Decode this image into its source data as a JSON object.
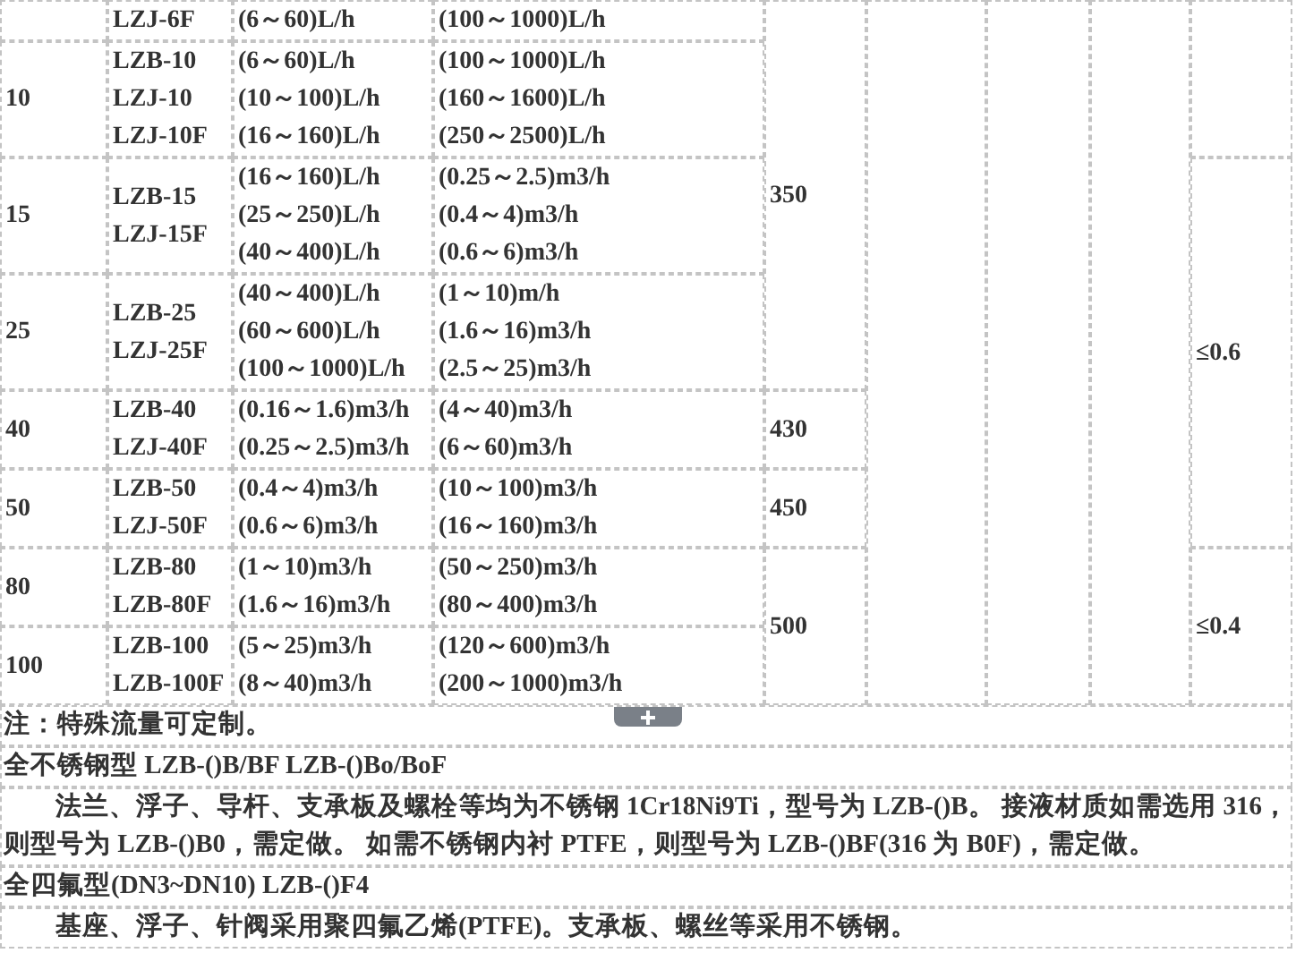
{
  "table": {
    "rows": [
      {
        "models": [
          "LZJ-6F"
        ],
        "range_1": [
          "(6～60)L/h"
        ],
        "range_2": [
          "(100～1000)L/h"
        ],
        "pressure": "350",
        "max_pressure": null
      },
      {
        "dn": "10",
        "models": [
          "LZB-10",
          "LZJ-10",
          "LZJ-10F"
        ],
        "range_1": [
          "(6～60)L/h",
          "(10～100)L/h",
          "(16～160)L/h"
        ],
        "range_2": [
          "(100～1000)L/h",
          "(160～1600)L/h",
          "(250～2500)L/h"
        ]
      },
      {
        "dn": "15",
        "models": [
          "LZB-15",
          "LZJ-15F"
        ],
        "range_1": [
          "(16～160)L/h",
          "(25～250)L/h",
          "(40～400)L/h"
        ],
        "range_2": [
          "(0.25～2.5)m3/h",
          "(0.4～4)m3/h",
          "(0.6～6)m3/h"
        ],
        "max_pressure": "≤0.6"
      },
      {
        "dn": "25",
        "models": [
          "LZB-25",
          "LZJ-25F"
        ],
        "range_1": [
          "(40～400)L/h",
          "(60～600)L/h",
          "(100～1000)L/h"
        ],
        "range_2": [
          "(1～10)m/h",
          "(1.6～16)m3/h",
          "(2.5～25)m3/h"
        ]
      },
      {
        "dn": "40",
        "models": [
          "LZB-40",
          "LZJ-40F"
        ],
        "range_1": [
          "(0.16～1.6)m3/h",
          "(0.25～2.5)m3/h"
        ],
        "range_2": [
          "(4～40)m3/h",
          "(6～60)m3/h"
        ],
        "pressure": "430"
      },
      {
        "dn": "50",
        "models": [
          "LZB-50",
          "LZJ-50F"
        ],
        "range_1": [
          "(0.4～4)m3/h",
          "(0.6～6)m3/h"
        ],
        "range_2": [
          "(10～100)m3/h",
          "(16～160)m3/h"
        ],
        "pressure": "450"
      },
      {
        "dn": "80",
        "models": [
          "LZB-80",
          "LZB-80F"
        ],
        "range_1": [
          "(1～10)m3/h",
          "(1.6～16)m3/h"
        ],
        "range_2": [
          "(50～250)m3/h",
          "(80～400)m3/h"
        ],
        "pressure": "500",
        "max_pressure": "≤0.4"
      },
      {
        "dn": "100",
        "models": [
          "LZB-100",
          "LZB-100F"
        ],
        "range_1": [
          "(5～25)m3/h",
          "(8～40)m3/h"
        ],
        "range_2": [
          "(120～600)m3/h",
          "(200～1000)m3/h"
        ]
      }
    ]
  },
  "note": "注：特殊流量可定制。",
  "sections": [
    {
      "heading": "全不锈钢型 LZB-()B/BF LZB-()Bo/BoF",
      "text": "法兰、浮子、导杆、支承板及螺栓等均为不锈钢 1Cr18Ni9Ti，型号为 LZB-()B。 接液材质如需选用 316，则型号为 LZB-()B0，需定做。 如需不锈钢内衬 PTFE，则型号为 LZB-()BF(316 为 B0F)，需定做。"
    },
    {
      "heading": "全四氟型(DN3~DN10) LZB-()F4",
      "text": "基座、浮子、针阀采用聚四氟乙烯(PTFE)。支承板、螺丝等采用不锈钢。"
    }
  ]
}
